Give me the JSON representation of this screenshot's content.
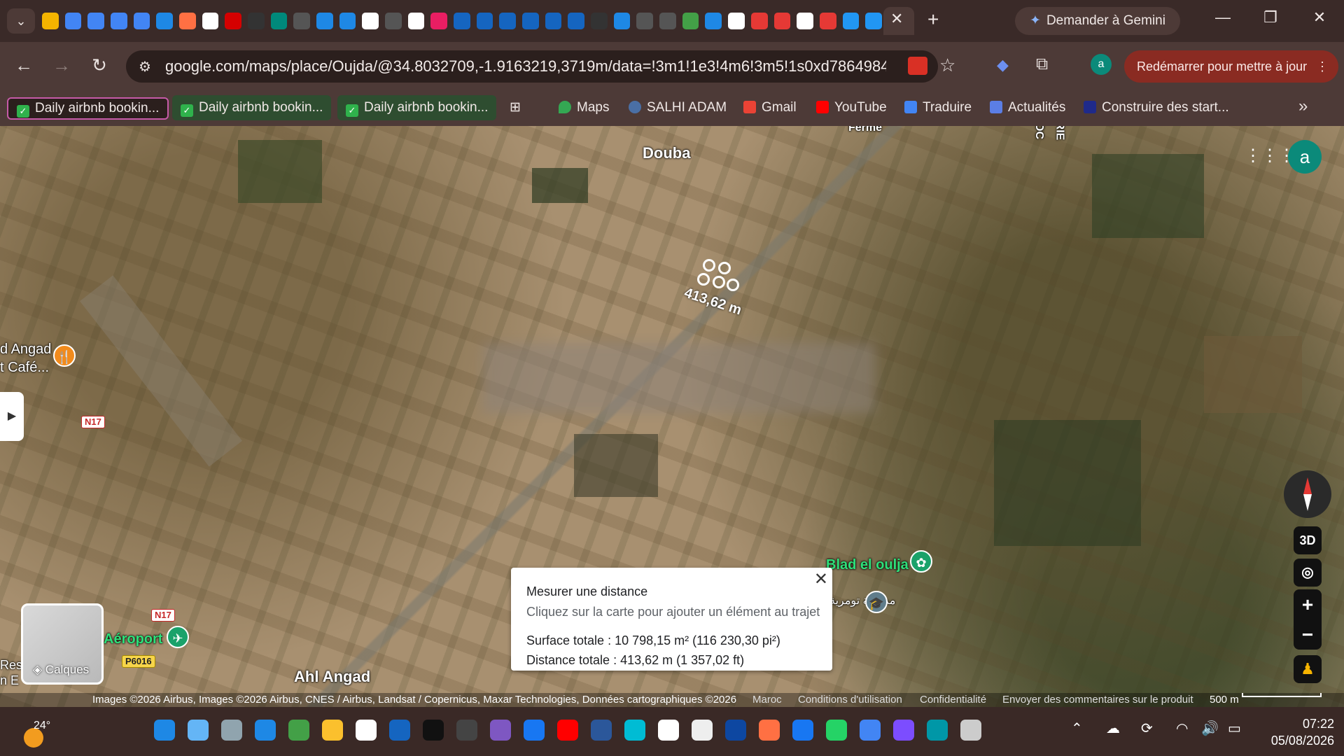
{
  "browser": {
    "tab_close": "✕",
    "new_tab": "+",
    "gemini_label": "Demander à Gemini",
    "window_controls": {
      "minimize": "—",
      "restore": "❐",
      "close": "✕"
    },
    "url": "google.com/maps/place/Oujda/@34.8032709,-1.9163219,3719m/data=!3m1!1e3!4m6!3m5!1s0xd7864984106d...",
    "restart_label": "Redémarrer pour mettre à jour",
    "profile_initial": "a"
  },
  "bookmarks": [
    {
      "label": "Daily airbnb bookin...",
      "icon": "check-icon"
    },
    {
      "label": "Daily airbnb bookin...",
      "icon": "check-icon"
    },
    {
      "label": "Daily airbnb bookin...",
      "icon": "check-icon"
    },
    {
      "label": "Maps",
      "icon": "maps-pin-icon"
    },
    {
      "label": "SALHI ADAM",
      "icon": "globe-icon"
    },
    {
      "label": "Gmail",
      "icon": "gmail-icon"
    },
    {
      "label": "YouTube",
      "icon": "youtube-icon"
    },
    {
      "label": "Traduire",
      "icon": "translate-icon"
    },
    {
      "label": "Actualités",
      "icon": "news-icon"
    },
    {
      "label": "Construire des start...",
      "icon": "bookmark-icon"
    }
  ],
  "map": {
    "labels": {
      "douba": "Douba",
      "ferme": "Ferme",
      "angad_cafe_1": "d Angad",
      "angad_cafe_2": "t Café...",
      "blad_el_oulja": "Blad el oulja",
      "aeroport": "Aéroport",
      "ahl_angad": "Ahl Angad",
      "arabic_school": "مدرسة تومرية",
      "edge_left_1": "Res",
      "edge_left_2": "n E",
      "road_n17": "N17",
      "road_n17b": "N17",
      "road_p6016": "P6016",
      "rie": "RIE",
      "oc": "OC"
    },
    "measurement_label": "413,62 m",
    "controls": {
      "d3": "3D",
      "zoom_in": "+",
      "zoom_out": "−"
    },
    "layers_label": "Calques",
    "map_avatar": "a"
  },
  "measure_panel": {
    "title": "Mesurer une distance",
    "hint": "Cliquez sur la carte pour ajouter un élément au trajet",
    "area": "Surface totale : 10 798,15 m² (116 230,30 pi²)",
    "distance": "Distance totale : 413,62 m (1 357,02 ft)"
  },
  "attribution": {
    "imagery": "Images ©2026 Airbus, Images ©2026 Airbus, CNES / Airbus, Landsat / Copernicus, Maxar Technologies, Données cartographiques ©2026",
    "country": "Maroc",
    "terms": "Conditions d'utilisation",
    "privacy": "Confidentialité",
    "feedback": "Envoyer des commentaires sur le produit",
    "scale": "500 m"
  },
  "taskbar": {
    "temperature": "24°",
    "time": "07:22",
    "date": "05/08/2026"
  }
}
